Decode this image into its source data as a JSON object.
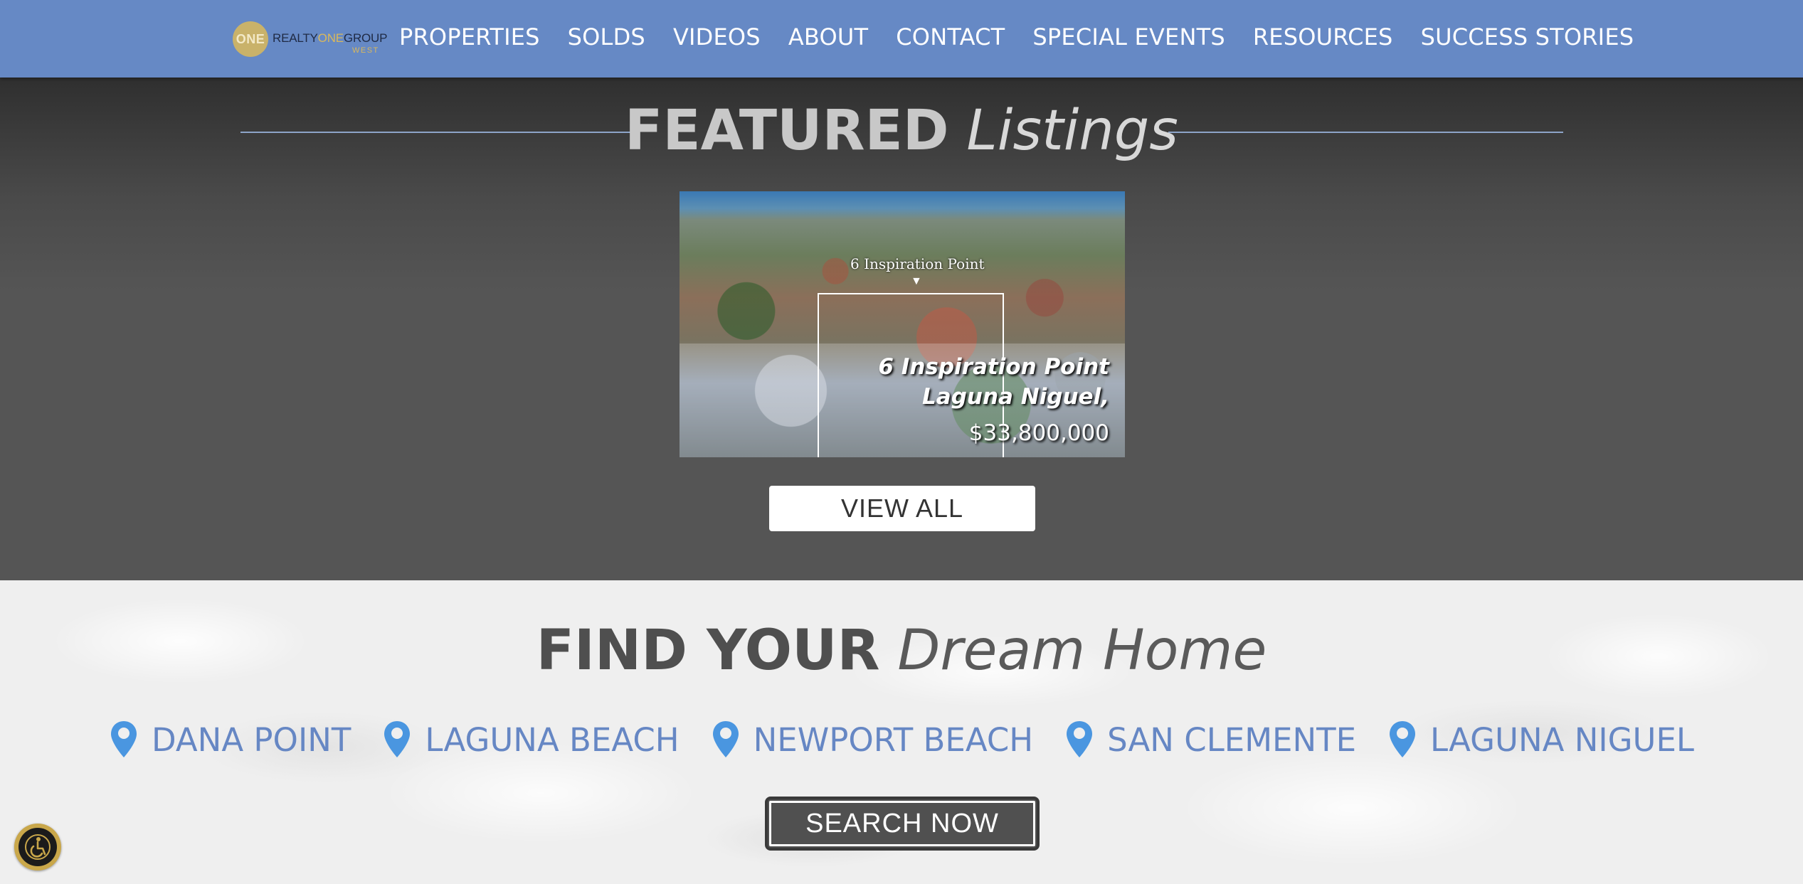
{
  "nav": {
    "logo": {
      "mark": "ONE",
      "text_a": "REALTY",
      "text_b": "ONE",
      "text_c": "GROUP",
      "sub": "WEST"
    },
    "items": [
      {
        "label": "PROPERTIES"
      },
      {
        "label": "SOLDS"
      },
      {
        "label": "VIDEOS"
      },
      {
        "label": "ABOUT"
      },
      {
        "label": "CONTACT"
      },
      {
        "label": "SPECIAL EVENTS"
      },
      {
        "label": "RESOURCES"
      },
      {
        "label": "SUCCESS STORIES"
      }
    ]
  },
  "featured": {
    "title_bold": "FEATURED",
    "title_italic": "Listings",
    "listing": {
      "photo_label": "6 Inspiration Point",
      "address_line1": "6 Inspiration Point",
      "address_line2": "Laguna Niguel,",
      "price": "$33,800,000"
    },
    "view_all_label": "VIEW ALL"
  },
  "dream": {
    "title_bold": "FIND YOUR",
    "title_italic": "Dream Home",
    "cities": [
      {
        "label": "DANA POINT",
        "icon": "map-pin-icon"
      },
      {
        "label": "LAGUNA BEACH",
        "icon": "map-pin-icon"
      },
      {
        "label": "NEWPORT BEACH",
        "icon": "map-pin-icon"
      },
      {
        "label": "SAN CLEMENTE",
        "icon": "map-pin-icon"
      },
      {
        "label": "LAGUNA NIGUEL",
        "icon": "map-pin-icon"
      }
    ],
    "search_label": "SEARCH NOW"
  },
  "accessibility": {
    "icon": "accessibility-icon"
  },
  "colors": {
    "nav_bg": "#6689c5",
    "city_text": "#6687c4",
    "pin": "#4a96e0",
    "logo_gold": "#c9b26a"
  }
}
